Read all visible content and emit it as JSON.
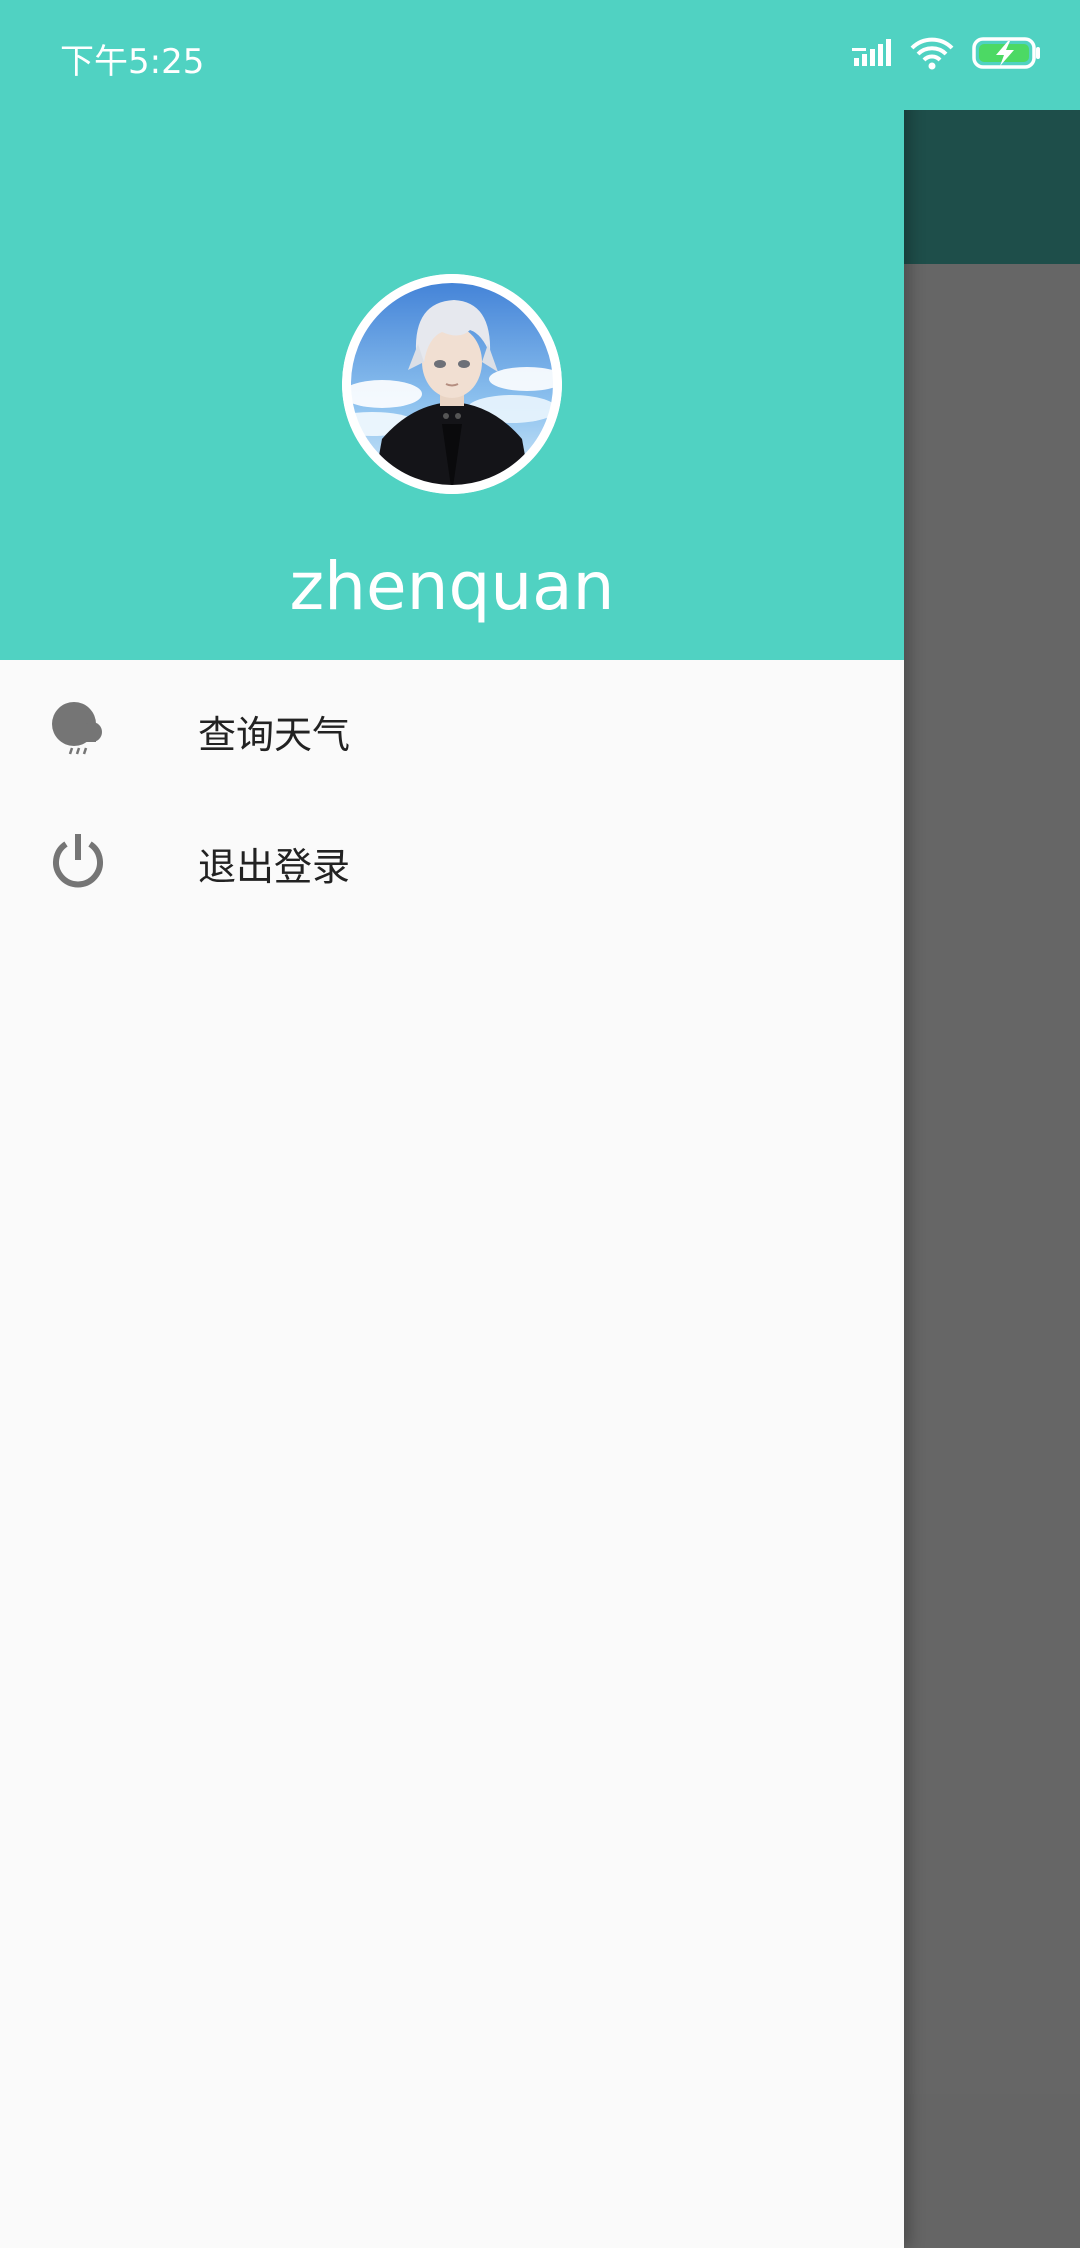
{
  "status_bar": {
    "time": "下午5:25",
    "icons": [
      "signal-icon",
      "wifi-icon",
      "battery-charging-icon"
    ]
  },
  "drawer": {
    "username": "zhenquan",
    "menu_items": [
      {
        "label": "查询天气",
        "icon": "weather-cloud-icon"
      },
      {
        "label": "退出登录",
        "icon": "power-icon"
      }
    ]
  },
  "background_app": {
    "toolbar_icons": [
      "overflow-menu-icon"
    ]
  },
  "colors": {
    "header": "#50d2c2",
    "drawer_bg": "#fafafa",
    "icon_gray": "#757575",
    "scrim_toolbar": "#1e4e4a",
    "scrim_content": "#666666",
    "battery_green": "#4cd964"
  }
}
